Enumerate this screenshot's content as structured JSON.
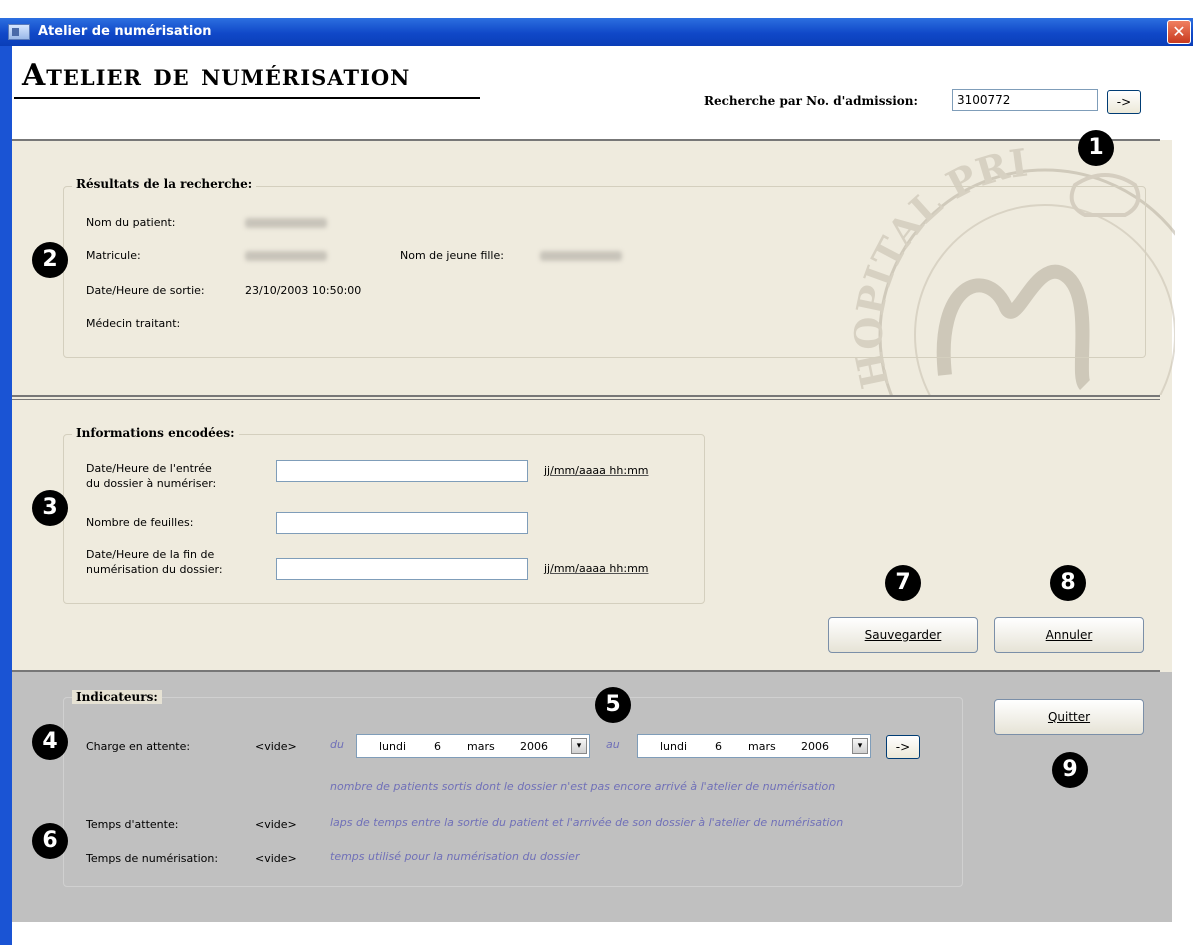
{
  "window": {
    "title": "Atelier de numérisation",
    "close_glyph": "✕"
  },
  "header": {
    "title": "Atelier de numérisation",
    "search_label": "Recherche par No. d'admission:",
    "search_value": "3100772",
    "search_button": "->"
  },
  "results": {
    "group_title": "Résultats de la recherche:",
    "patient_name_label": "Nom du patient:",
    "matricule_label": "Matricule:",
    "maiden_name_label": "Nom de jeune fille:",
    "discharge_label": "Date/Heure de sortie:",
    "discharge_value": "23/10/2003 10:50:00",
    "doctor_label": "Médecin traitant:"
  },
  "encoded": {
    "group_title": "Informations encodées:",
    "entry_label_1": "Date/Heure de l'entrée",
    "entry_label_2": "du dossier à numériser:",
    "entry_hint": "jj/mm/aaaa hh:mm",
    "sheets_label": "Nombre de feuilles:",
    "end_label_1": "Date/Heure de la fin de",
    "end_label_2": "numérisation du dossier:",
    "end_hint": "jj/mm/aaaa hh:mm"
  },
  "actions": {
    "save": "Sauvegarder",
    "cancel": "Annuler",
    "quit": "Quitter"
  },
  "indicators": {
    "group_title": "Indicateurs:",
    "charge_label": "Charge en attente:",
    "charge_value": "<vide>",
    "from_label": "du",
    "to_label": "au",
    "date_from": {
      "weekday": "lundi",
      "day": "6",
      "month": "mars",
      "year": "2006"
    },
    "date_to": {
      "weekday": "lundi",
      "day": "6",
      "month": "mars",
      "year": "2006"
    },
    "go_button": "->",
    "charge_desc": "nombre de patients sortis dont le dossier n'est pas encore arrivé à l'atelier de numérisation",
    "wait_label": "Temps d'attente:",
    "wait_value": "<vide>",
    "wait_desc": "laps de temps entre la sortie du patient et l'arrivée de son dossier à l'atelier de numérisation",
    "scan_label": "Temps de numérisation:",
    "scan_value": "<vide>",
    "scan_desc": "temps utilisé pour la numérisation du dossier"
  },
  "markers": [
    "1",
    "2",
    "3",
    "4",
    "5",
    "6",
    "7",
    "8",
    "9"
  ],
  "watermark_text": "HOPITAL PRIN",
  "colors": {
    "titlebar": "#1048c8",
    "panel_beige": "#efebde",
    "panel_grey": "#c0c0c0",
    "description": "#7070b8"
  }
}
